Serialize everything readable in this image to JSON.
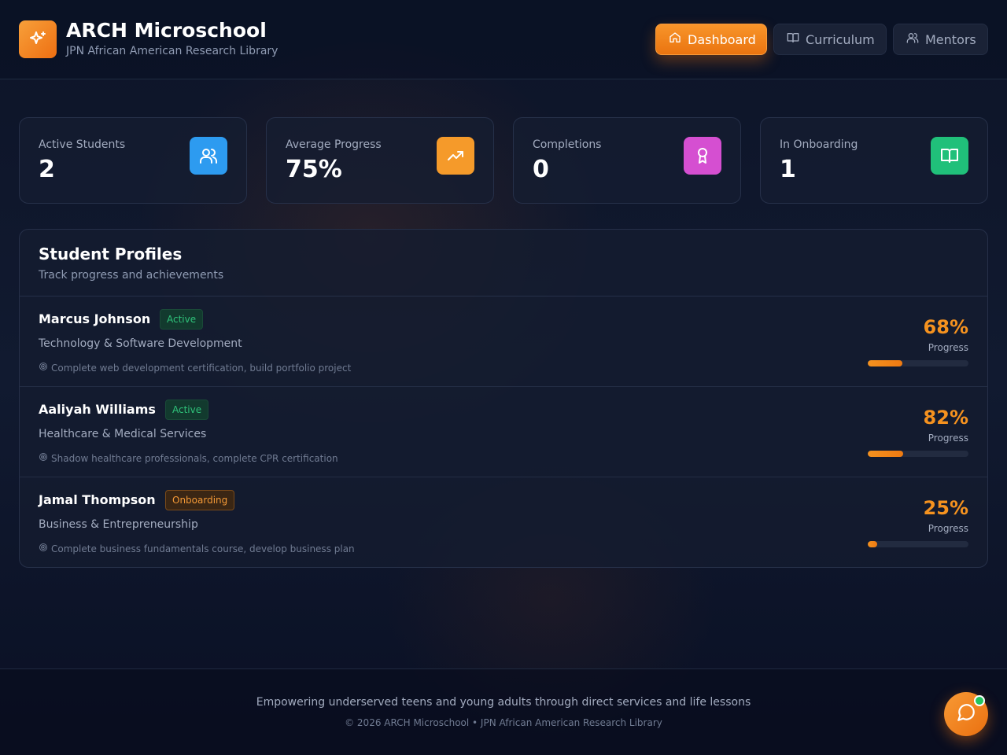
{
  "header": {
    "title": "ARCH Microschool",
    "subtitle": "JPN African American Research Library",
    "logo_icon": "sparkles-icon",
    "nav": [
      {
        "label": "Dashboard",
        "icon": "home-icon",
        "active": true
      },
      {
        "label": "Curriculum",
        "icon": "book-icon",
        "active": false
      },
      {
        "label": "Mentors",
        "icon": "users-icon",
        "active": false
      }
    ]
  },
  "stats": [
    {
      "label": "Active Students",
      "value": "2",
      "icon": "users-icon",
      "color": "#2d9bf0"
    },
    {
      "label": "Average Progress",
      "value": "75%",
      "icon": "trending-up-icon",
      "color": "#f59a2a"
    },
    {
      "label": "Completions",
      "value": "0",
      "icon": "award-icon",
      "color": "#d54fd1"
    },
    {
      "label": "In Onboarding",
      "value": "1",
      "icon": "book-open-icon",
      "color": "#20c07a"
    }
  ],
  "profiles": {
    "title": "Student Profiles",
    "subtitle": "Track progress and achievements",
    "progress_label": "Progress",
    "students": [
      {
        "name": "Marcus Johnson",
        "status": "Active",
        "field": "Technology & Software Development",
        "goal": "Complete web development certification, build portfolio project",
        "progress_text": "68%",
        "progress": 0.34
      },
      {
        "name": "Aaliyah Williams",
        "status": "Active",
        "field": "Healthcare & Medical Services",
        "goal": "Shadow healthcare professionals, complete CPR certification",
        "progress_text": "82%",
        "progress": 0.35
      },
      {
        "name": "Jamal Thompson",
        "status": "Onboarding",
        "field": "Business & Entrepreneurship",
        "goal": "Complete business fundamentals course, develop business plan",
        "progress_text": "25%",
        "progress": 0.09
      }
    ]
  },
  "footer": {
    "tagline": "Empowering underserved teens and young adults through direct services and life lessons",
    "copyright": "© 2026 ARCH Microschool • JPN African American Research Library"
  },
  "chat": {
    "icon": "message-circle-icon",
    "accent": "#22c55e"
  },
  "colors": {
    "accent": "#f5921f",
    "background": "#0b1226"
  }
}
